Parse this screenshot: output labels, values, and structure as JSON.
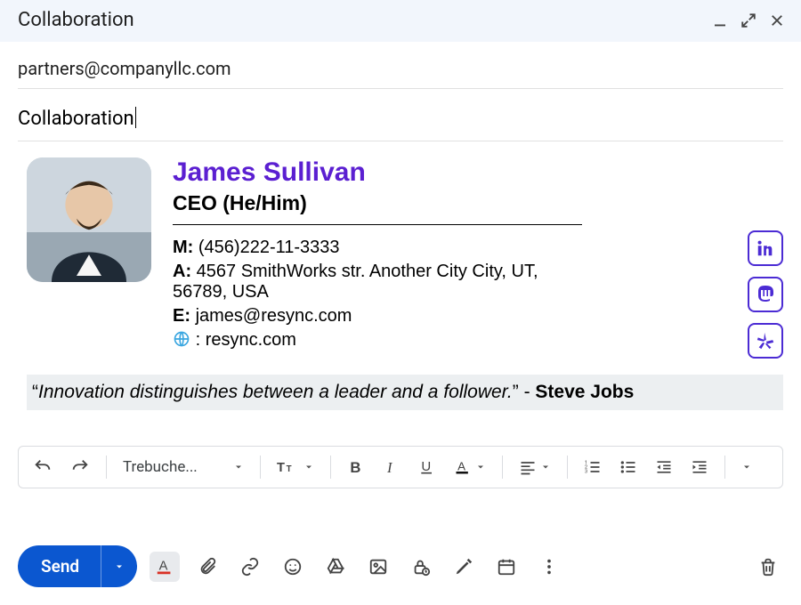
{
  "window": {
    "title": "Collaboration"
  },
  "fields": {
    "to": "partners@companyllc.com",
    "subject": "Collaboration"
  },
  "signature": {
    "name": "James Sullivan",
    "title": "CEO (He/Him)",
    "mobile_label": "M:",
    "mobile": "(456)222-11-3333",
    "address_label": "A:",
    "address": "4567 SmithWorks str. Another City City, UT, 56789, USA",
    "email_label": "E:",
    "email": "james@resync.com",
    "web_sep": ":",
    "website": "resync.com"
  },
  "quote": {
    "open": "“",
    "text": "Innovation distinguishes between a leader and a follower.",
    "close": "”",
    "sep": " - ",
    "author": "Steve Jobs"
  },
  "toolbar": {
    "font_name": "Trebuche..."
  },
  "send": {
    "label": "Send"
  }
}
